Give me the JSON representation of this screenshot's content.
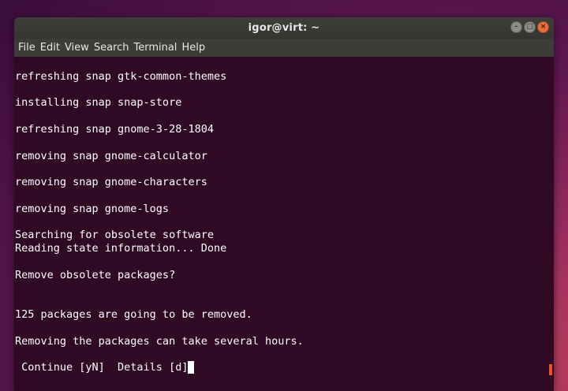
{
  "window": {
    "title": "igor@virt: ~"
  },
  "menu": [
    "File",
    "Edit",
    "View",
    "Search",
    "Terminal",
    "Help"
  ],
  "terminal": {
    "lines": [
      "",
      "refreshing snap gtk-common-themes",
      "",
      "installing snap snap-store",
      "",
      "refreshing snap gnome-3-28-1804",
      "",
      "removing snap gnome-calculator",
      "",
      "removing snap gnome-characters",
      "",
      "removing snap gnome-logs",
      "",
      "Searching for obsolete software",
      "Reading state information... Done",
      "",
      "Remove obsolete packages?",
      "",
      "",
      "125 packages are going to be removed.",
      "",
      "Removing the packages can take several hours.",
      ""
    ],
    "prompt": " Continue [yN]  Details [d]"
  },
  "colors": {
    "terminal_bg": "#300a24",
    "accent": "#e95420"
  }
}
